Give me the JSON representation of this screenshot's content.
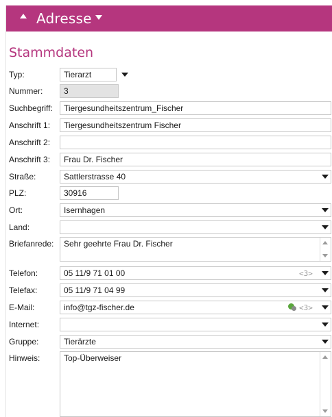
{
  "window": {
    "title": "Adresse"
  },
  "section": {
    "title": "Stammdaten"
  },
  "labels": {
    "typ": "Typ:",
    "nummer": "Nummer:",
    "suchbegriff": "Suchbegriff:",
    "anschrift1": "Anschrift 1:",
    "anschrift2": "Anschrift 2:",
    "anschrift3": "Anschrift 3:",
    "strasse": "Straße:",
    "plz": "PLZ:",
    "ort": "Ort:",
    "land": "Land:",
    "briefanrede": "Briefanrede:",
    "telefon": "Telefon:",
    "telefax": "Telefax:",
    "email": "E-Mail:",
    "internet": "Internet:",
    "gruppe": "Gruppe:",
    "hinweis": "Hinweis:"
  },
  "values": {
    "typ": "Tierarzt",
    "nummer": "3",
    "suchbegriff": "Tiergesundheitszentrum_Fischer",
    "anschrift1": "Tiergesundheitszentrum Fischer",
    "anschrift2": "",
    "anschrift3": "Frau Dr. Fischer",
    "strasse": "Sattlerstrasse 40",
    "plz": "30916",
    "ort": "Isernhagen",
    "land": "",
    "briefanrede": "Sehr geehrte Frau Dr. Fischer",
    "telefon": "05 11/9 71 01 00",
    "telefax": "05 11/9 71 04 99",
    "email": "info@tgz-fischer.de",
    "internet": "",
    "gruppe": "Tierärzte",
    "hinweis": "Top-Überweiser"
  },
  "counts": {
    "telefon": "<3>",
    "email": "<3>"
  },
  "colors": {
    "accent": "#b5367e"
  }
}
